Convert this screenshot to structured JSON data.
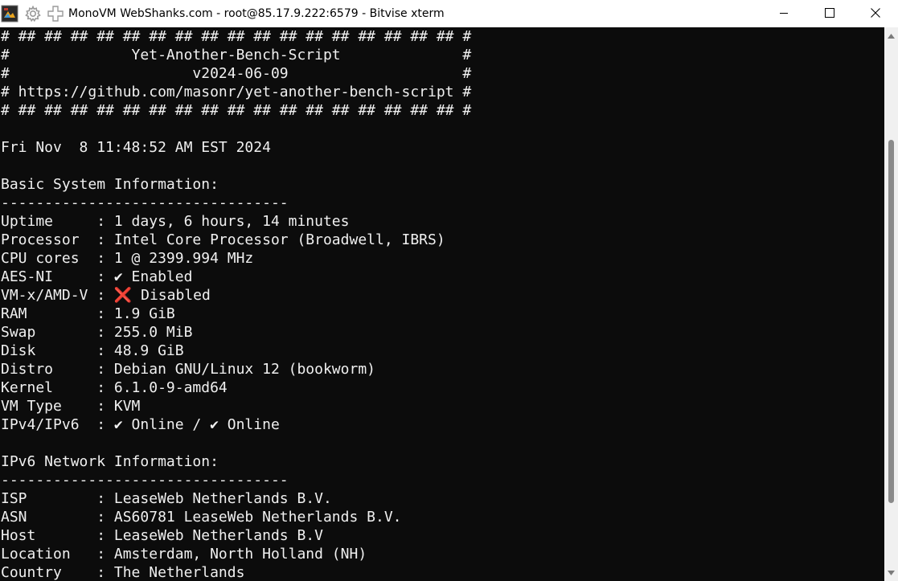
{
  "window": {
    "title": "MonoVM WebShanks.com - root@85.17.9.222:6579 - Bitvise xterm",
    "minimize_icon": "minimize-icon",
    "maximize_icon": "maximize-icon",
    "close_icon": "close-icon"
  },
  "terminal": {
    "lines": [
      "# ## ## ## ## ## ## ## ## ## ## ## ## ## ## ## ## ## #",
      "#              Yet-Another-Bench-Script              #",
      "#                     v2024-06-09                    #",
      "# https://github.com/masonr/yet-another-bench-script #",
      "# ## ## ## ## ## ## ## ## ## ## ## ## ## ## ## ## ## #",
      "",
      "Fri Nov  8 11:48:52 AM EST 2024",
      "",
      "Basic System Information:",
      "---------------------------------",
      "Uptime     : 1 days, 6 hours, 14 minutes",
      "Processor  : Intel Core Processor (Broadwell, IBRS)",
      "CPU cores  : 1 @ 2399.994 MHz",
      "AES-NI     : ✔ Enabled",
      "VM-x/AMD-V : ❌ Disabled",
      "RAM        : 1.9 GiB",
      "Swap       : 255.0 MiB",
      "Disk       : 48.9 GiB",
      "Distro     : Debian GNU/Linux 12 (bookworm)",
      "Kernel     : 6.1.0-9-amd64",
      "VM Type    : KVM",
      "IPv4/IPv6  : ✔ Online / ✔ Online",
      "",
      "IPv6 Network Information:",
      "---------------------------------",
      "ISP        : LeaseWeb Netherlands B.V.",
      "ASN        : AS60781 LeaseWeb Netherlands B.V.",
      "Host       : LeaseWeb Netherlands B.V",
      "Location   : Amsterdam, North Holland (NH)",
      "Country    : The Netherlands"
    ]
  },
  "colors": {
    "terminal_bg": "#0c0c0c",
    "terminal_fg": "#f0f0f0",
    "titlebar_bg": "#ffffff"
  }
}
